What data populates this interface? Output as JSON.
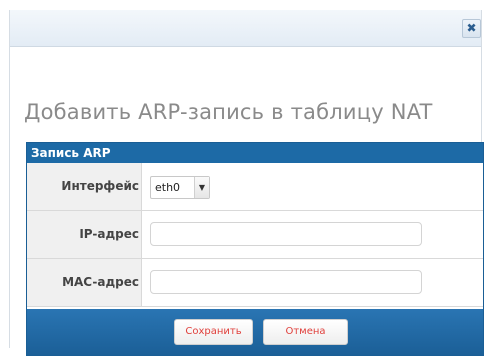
{
  "dialog": {
    "close_icon": "close-icon",
    "close_glyph": "✖",
    "heading": "Добавить ARP-запись в таблицу NAT"
  },
  "panel": {
    "title": "Запись ARP",
    "fields": {
      "interface": {
        "label": "Интерфейс",
        "value": "eth0",
        "arrow_icon": "chevron-down-icon"
      },
      "ip": {
        "label": "IP-адрес",
        "value": "",
        "placeholder": ""
      },
      "mac": {
        "label": "MAC-адрес",
        "value": "",
        "placeholder": ""
      }
    }
  },
  "buttons": {
    "save_label": "Сохранить",
    "cancel_label": "Отмена"
  },
  "colors": {
    "panel_header": "#1d6aa6",
    "footer": "#1b5f97",
    "button_text": "#e0403c",
    "heading": "#8a8a8a"
  }
}
